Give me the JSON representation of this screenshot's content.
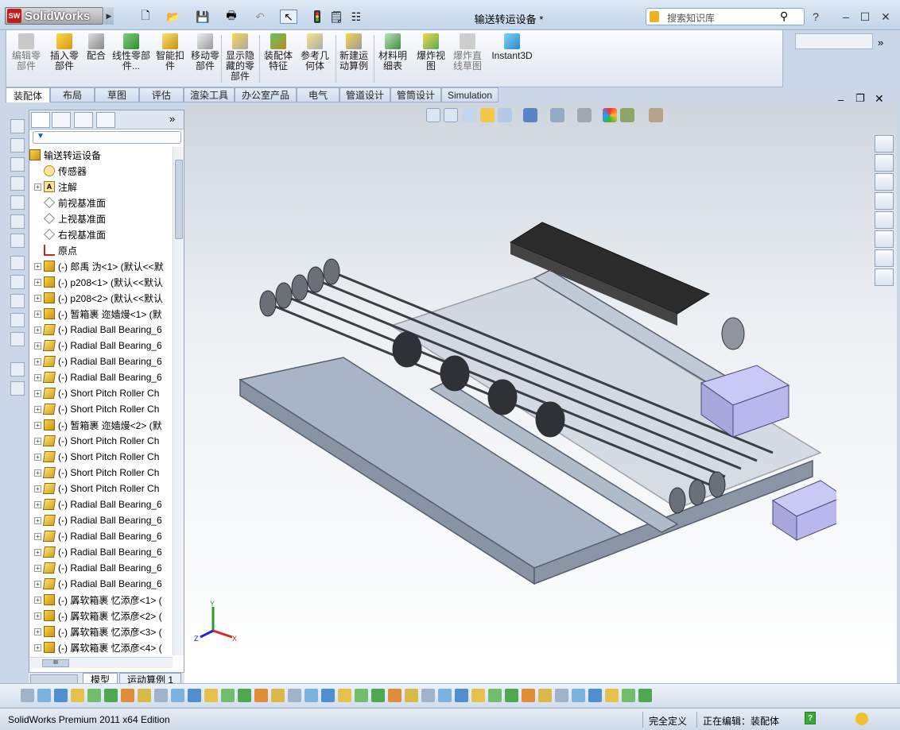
{
  "app": {
    "name": "SolidWorks",
    "logo_badge": "SW",
    "edition": "SolidWorks Premium 2011 x64 Edition"
  },
  "window": {
    "title": "输送转运设备 *"
  },
  "search": {
    "placeholder": "搜索知识库"
  },
  "ribbon": {
    "buttons": [
      {
        "label": "编辑零部件",
        "icon": "edit-component-icon",
        "disabled": true
      },
      {
        "label": "插入零部件",
        "icon": "insert-component-icon"
      },
      {
        "label": "配合",
        "icon": "mate-icon"
      },
      {
        "label": "线性零部件...",
        "icon": "linear-pattern-icon"
      },
      {
        "label": "智能扣件",
        "icon": "smart-fastener-icon"
      },
      {
        "label": "移动零部件",
        "icon": "move-component-icon"
      },
      {
        "label": "显示隐藏的零部件",
        "icon": "show-hidden-icon"
      },
      {
        "label": "装配体特征",
        "icon": "assembly-feature-icon"
      },
      {
        "label": "参考几何体",
        "icon": "reference-geometry-icon"
      },
      {
        "label": "新建运动算例",
        "icon": "motion-study-icon"
      },
      {
        "label": "材料明细表",
        "icon": "bom-icon"
      },
      {
        "label": "爆炸视图",
        "icon": "exploded-view-icon"
      },
      {
        "label": "爆炸直线草图",
        "icon": "explode-line-icon",
        "disabled": true
      },
      {
        "label": "Instant3D",
        "icon": "instant3d-icon"
      }
    ]
  },
  "tabs": [
    "装配体",
    "布局",
    "草图",
    "评估",
    "渲染工具",
    "办公室产品",
    "电气",
    "管道设计",
    "管筒设计",
    "Simulation"
  ],
  "feature_tree": {
    "root": "输送转运设备",
    "items": [
      {
        "label": "传感器",
        "icon": "sensor-icon"
      },
      {
        "label": "注解",
        "icon": "annotation-icon",
        "expandable": true
      },
      {
        "label": "前视基准面",
        "icon": "plane-icon"
      },
      {
        "label": "上视基准面",
        "icon": "plane-icon"
      },
      {
        "label": "右视基准面",
        "icon": "plane-icon"
      },
      {
        "label": "原点",
        "icon": "origin-icon"
      },
      {
        "label": "(-) 郎禹 沩<1> (默认<<默",
        "icon": "assembly-icon",
        "expandable": true
      },
      {
        "label": "(-) p208<1> (默认<<默认",
        "icon": "assembly-icon",
        "expandable": true
      },
      {
        "label": "(-) p208<2> (默认<<默认",
        "icon": "assembly-icon",
        "expandable": true
      },
      {
        "label": "(-) 暂箱裹 迩嫱熳<1> (默",
        "icon": "assembly-icon",
        "expandable": true
      },
      {
        "label": "(-) Radial Ball Bearing_6",
        "icon": "part-icon",
        "expandable": true
      },
      {
        "label": "(-) Radial Ball Bearing_6",
        "icon": "part-icon",
        "expandable": true
      },
      {
        "label": "(-) Radial Ball Bearing_6",
        "icon": "part-icon",
        "expandable": true
      },
      {
        "label": "(-) Radial Ball Bearing_6",
        "icon": "part-icon",
        "expandable": true
      },
      {
        "label": "(-) Short Pitch Roller Ch",
        "icon": "part-icon",
        "expandable": true
      },
      {
        "label": "(-) Short Pitch Roller Ch",
        "icon": "part-icon",
        "expandable": true
      },
      {
        "label": "(-) 暂箱裹 迩嫱熳<2> (默",
        "icon": "assembly-icon",
        "expandable": true
      },
      {
        "label": "(-) Short Pitch Roller Ch",
        "icon": "part-icon",
        "expandable": true
      },
      {
        "label": "(-) Short Pitch Roller Ch",
        "icon": "part-icon",
        "expandable": true
      },
      {
        "label": "(-) Short Pitch Roller Ch",
        "icon": "part-icon",
        "expandable": true
      },
      {
        "label": "(-) Short Pitch Roller Ch",
        "icon": "part-icon",
        "expandable": true
      },
      {
        "label": "(-) Radial Ball Bearing_6",
        "icon": "part-icon",
        "expandable": true
      },
      {
        "label": "(-) Radial Ball Bearing_6",
        "icon": "part-icon",
        "expandable": true
      },
      {
        "label": "(-) Radial Ball Bearing_6",
        "icon": "part-icon",
        "expandable": true
      },
      {
        "label": "(-) Radial Ball Bearing_6",
        "icon": "part-icon",
        "expandable": true
      },
      {
        "label": "(-) Radial Ball Bearing_6",
        "icon": "part-icon",
        "expandable": true
      },
      {
        "label": "(-) Radial Ball Bearing_6",
        "icon": "part-icon",
        "expandable": true
      },
      {
        "label": "(-) 羼软箱裹 忆添彦<1> (",
        "icon": "assembly-icon",
        "expandable": true
      },
      {
        "label": "(-) 羼软箱裹 忆添彦<2> (",
        "icon": "assembly-icon",
        "expandable": true
      },
      {
        "label": "(-) 羼软箱裹 忆添彦<3> (",
        "icon": "assembly-icon",
        "expandable": true
      },
      {
        "label": "(-) 羼软箱裹 忆添彦<4> (",
        "icon": "assembly-icon",
        "expandable": true
      }
    ],
    "bottom_tabs": [
      "模型",
      "运动算例 1"
    ],
    "hscroll_glyph": "III"
  },
  "status": {
    "definition": "完全定义",
    "editing": "正在编辑：装配体",
    "help": "?"
  },
  "colors": {
    "title_bg": "#c3d5ea",
    "logo_red": "#c21d1d",
    "frame": "#a9b4c6",
    "belt": "#2b2b2b",
    "motor": "#b8b8ee"
  }
}
